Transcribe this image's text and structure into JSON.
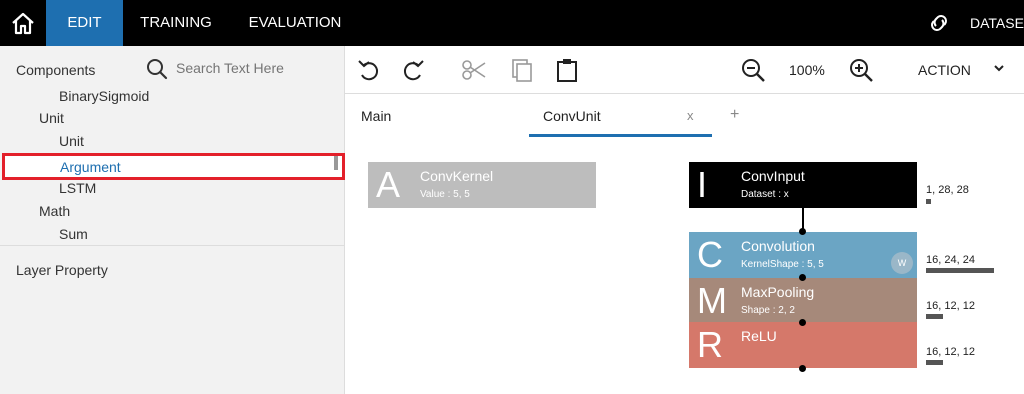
{
  "nav": {
    "tabs": [
      "EDIT",
      "TRAINING",
      "EVALUATION"
    ],
    "active": "EDIT",
    "dataset_label": "DATASET",
    "home_icon": "home-icon",
    "dataset_icon": "link-icon",
    "accent": "#1e6fb0"
  },
  "sidebar": {
    "components_label": "Components",
    "search_placeholder": "Search Text Here",
    "tree": [
      {
        "label": "BinarySigmoid",
        "level": 2
      },
      {
        "label": "Unit",
        "level": 1
      },
      {
        "label": "Unit",
        "level": 2
      },
      {
        "label": "Argument",
        "level": 2,
        "selected": true
      },
      {
        "label": "LSTM",
        "level": 2
      },
      {
        "label": "Math",
        "level": 1
      },
      {
        "label": "Sum",
        "level": 2
      }
    ],
    "layer_property_label": "Layer Property",
    "highlight_color": "#e3202a"
  },
  "toolbar": {
    "icons": [
      "undo-icon",
      "redo-icon",
      "cut-icon",
      "copy-icon",
      "paste-icon",
      "zoom-out-icon",
      "zoom-in-icon"
    ],
    "zoom": "100%",
    "action_label": "ACTION"
  },
  "editor_tabs": {
    "tabs": [
      "Main",
      "ConvUnit"
    ],
    "active": "ConvUnit",
    "close_glyph": "x",
    "add_glyph": "+"
  },
  "canvas": {
    "kernel": {
      "letter": "A",
      "name": "ConvKernel",
      "sub": "Value : 5, 5",
      "color": "#bdbdbd"
    },
    "layers": [
      {
        "letter": "I",
        "name": "ConvInput",
        "sub": "Dataset : x",
        "color": "#000000",
        "shape": "1, 28, 28",
        "shape_bar": 0.07
      },
      {
        "letter": "C",
        "name": "Convolution",
        "sub": "KernelShape : 5, 5",
        "color": "#6ba5c4",
        "badge": "W",
        "shape": "16, 24, 24",
        "shape_bar": 1.0
      },
      {
        "letter": "M",
        "name": "MaxPooling",
        "sub": "Shape : 2, 2",
        "color": "#a6897a",
        "shape": "16, 12, 12",
        "shape_bar": 0.25
      },
      {
        "letter": "R",
        "name": "ReLU",
        "sub": "",
        "color": "#d5786a",
        "shape": "16, 12, 12",
        "shape_bar": 0.25
      }
    ]
  }
}
